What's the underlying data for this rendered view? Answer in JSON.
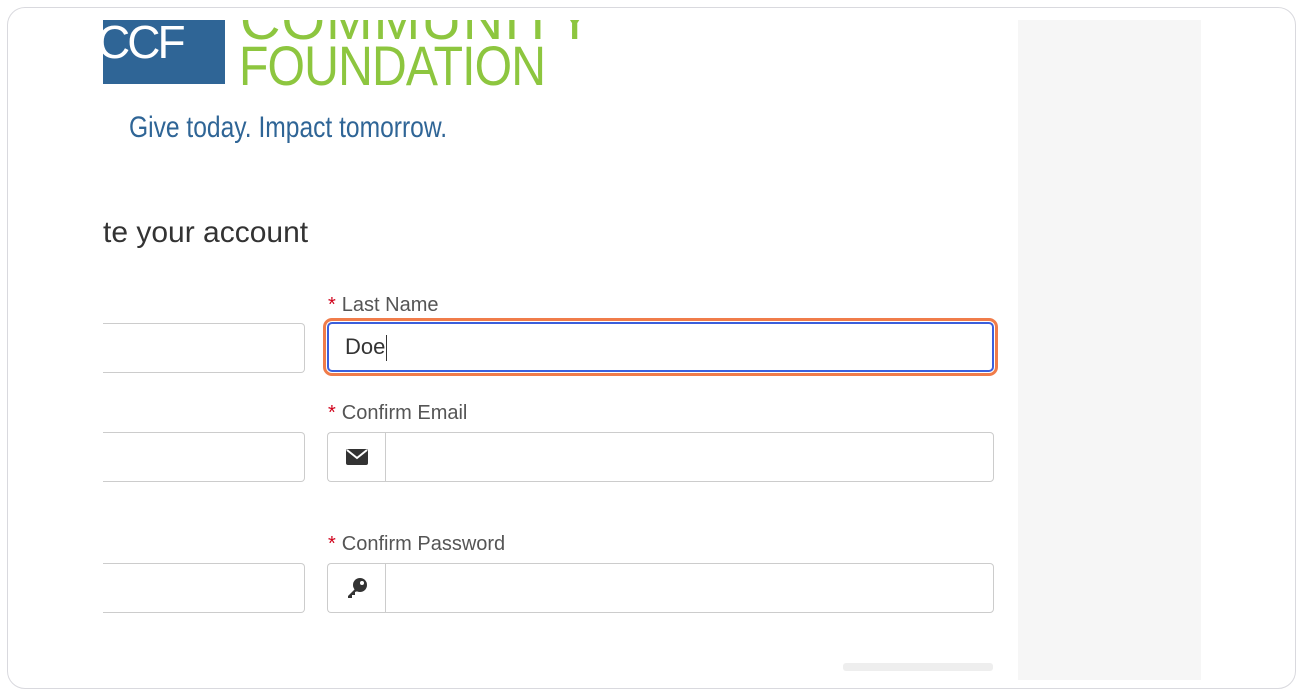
{
  "logo": {
    "initials": "CCF",
    "top_word": "COMMUNITY",
    "word": "FOUNDATION",
    "tagline": "Give today. Impact tomorrow."
  },
  "form": {
    "heading": "te your account",
    "required_marker": "*",
    "last_name": {
      "label": "Last Name",
      "value": "Doe"
    },
    "confirm_email": {
      "label": "Confirm Email",
      "value": ""
    },
    "confirm_password": {
      "label": "Confirm Password",
      "value": ""
    }
  },
  "icons": {
    "email": "envelope-icon",
    "password": "key-icon"
  },
  "colors": {
    "brand_blue": "#2f6596",
    "brand_green": "#8dc63f",
    "focus_outline": "#f07c4a",
    "focus_border": "#3b5fdc",
    "required": "#d0021b"
  }
}
